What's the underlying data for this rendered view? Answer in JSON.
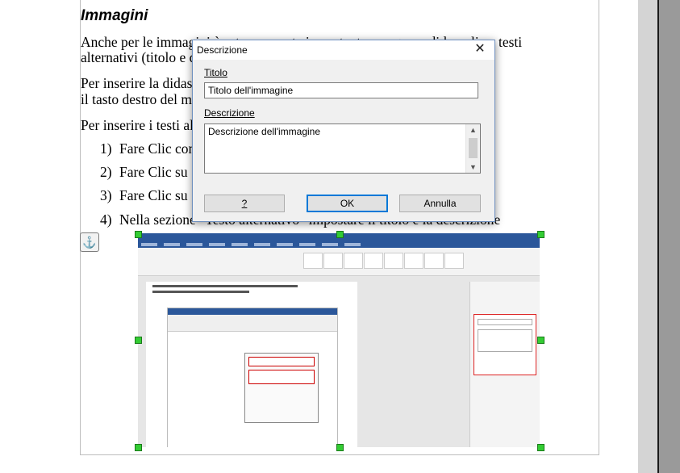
{
  "document": {
    "heading": "Immagini",
    "paragraphs": [
      "Anche per le immagini è estremamente importante assegnare didascalia e testi",
      "alternativi (titolo e descrizione)",
      "Per inserire la didascalia all'immagine è necessario cliccare con",
      "il tasto destro del mouse e selezionare \"Inserisci didascalia…\"",
      "Per inserire i testi alternativi:"
    ],
    "list": [
      {
        "num": "1)",
        "text": "Fare Clic con il tasto destro sull'immagine"
      },
      {
        "num": "2)",
        "text": "Fare Clic su \"Proprietà\""
      },
      {
        "num": "3)",
        "text": "Fare Clic su \"Opzioni\""
      },
      {
        "num": "4)",
        "text": "Nella sezione \"Testo alternativo\" impostare il titolo e la descrizione"
      }
    ],
    "anchor_icon": "anchor-icon"
  },
  "dialog": {
    "title": "Descrizione",
    "title_label": "Titolo",
    "title_value": "Titolo dell'immagine",
    "description_label": "Descrizione",
    "description_value": "Descrizione dell'immagine",
    "help_label": "?",
    "ok_label": "OK",
    "cancel_label": "Annulla",
    "close_icon": "close-icon"
  },
  "colors": {
    "word_blue": "#2b579a",
    "handle_green": "#33cc33",
    "ok_border": "#0078d7",
    "highlight_red": "#d22222"
  }
}
